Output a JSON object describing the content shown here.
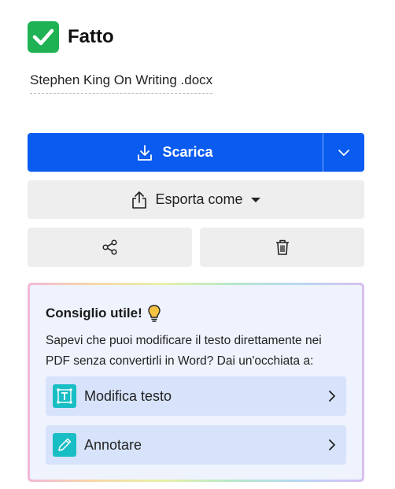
{
  "status": {
    "title": "Fatto",
    "color": "#1fb254"
  },
  "file": {
    "name": "Stephen King On Writing .docx"
  },
  "actions": {
    "download_label": "Scarica",
    "export_label": "Esporta come",
    "download_color": "#0a5bf0",
    "icons": [
      "download-icon",
      "chevron-down-icon",
      "share-export-icon",
      "caret-down-icon",
      "share-icon",
      "trash-icon"
    ]
  },
  "tip": {
    "title": "Consiglio utile!",
    "body": "Sapevi che puoi modificare il testo direttamente nei PDF senza convertirli in Word? Dai un'occhiata a:",
    "links": [
      {
        "label": "Modifica testo",
        "icon": "edit-text-icon"
      },
      {
        "label": "Annotare",
        "icon": "pencil-icon"
      }
    ]
  }
}
